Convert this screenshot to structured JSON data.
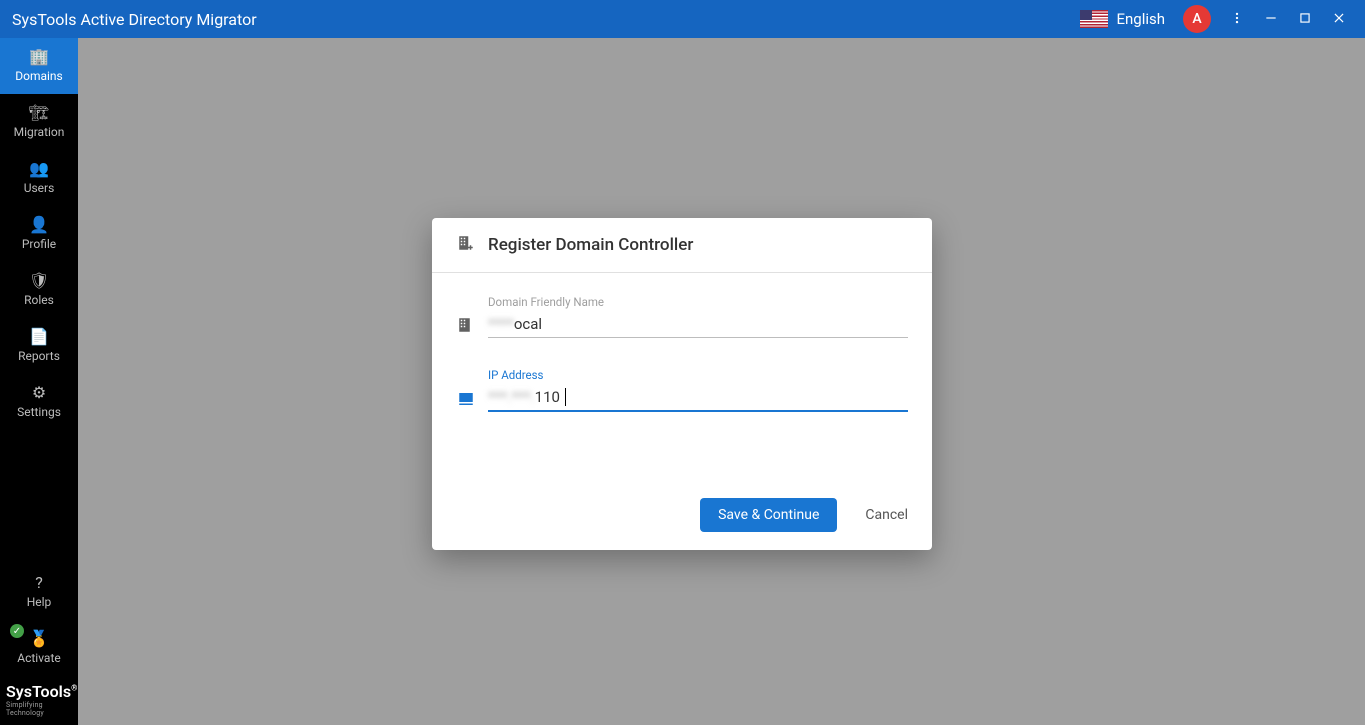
{
  "titlebar": {
    "title": "SysTools Active Directory Migrator",
    "language": "English",
    "avatar_letter": "A"
  },
  "sidebar": {
    "items": [
      {
        "label": "Domains",
        "icon": "building-icon"
      },
      {
        "label": "Migration",
        "icon": "building-plus-icon"
      },
      {
        "label": "Users",
        "icon": "users-icon"
      },
      {
        "label": "Profile",
        "icon": "person-icon"
      },
      {
        "label": "Roles",
        "icon": "role-icon"
      },
      {
        "label": "Reports",
        "icon": "file-icon"
      },
      {
        "label": "Settings",
        "icon": "gear-icon"
      }
    ],
    "footer_items": [
      {
        "label": "Help",
        "icon": "question-icon"
      },
      {
        "label": "Activate",
        "icon": "badge-icon"
      }
    ],
    "brand": {
      "main": "SysTools",
      "sub": "Simplifying Technology"
    }
  },
  "modal": {
    "title": "Register Domain Controller",
    "fields": {
      "domain_name": {
        "label": "Domain Friendly Name",
        "prefix_hidden": "****",
        "value_visible": "ocal"
      },
      "ip_address": {
        "label": "IP Address",
        "prefix_hidden": "***.***.",
        "value_visible": "110"
      }
    },
    "buttons": {
      "save": "Save & Continue",
      "cancel": "Cancel"
    }
  }
}
